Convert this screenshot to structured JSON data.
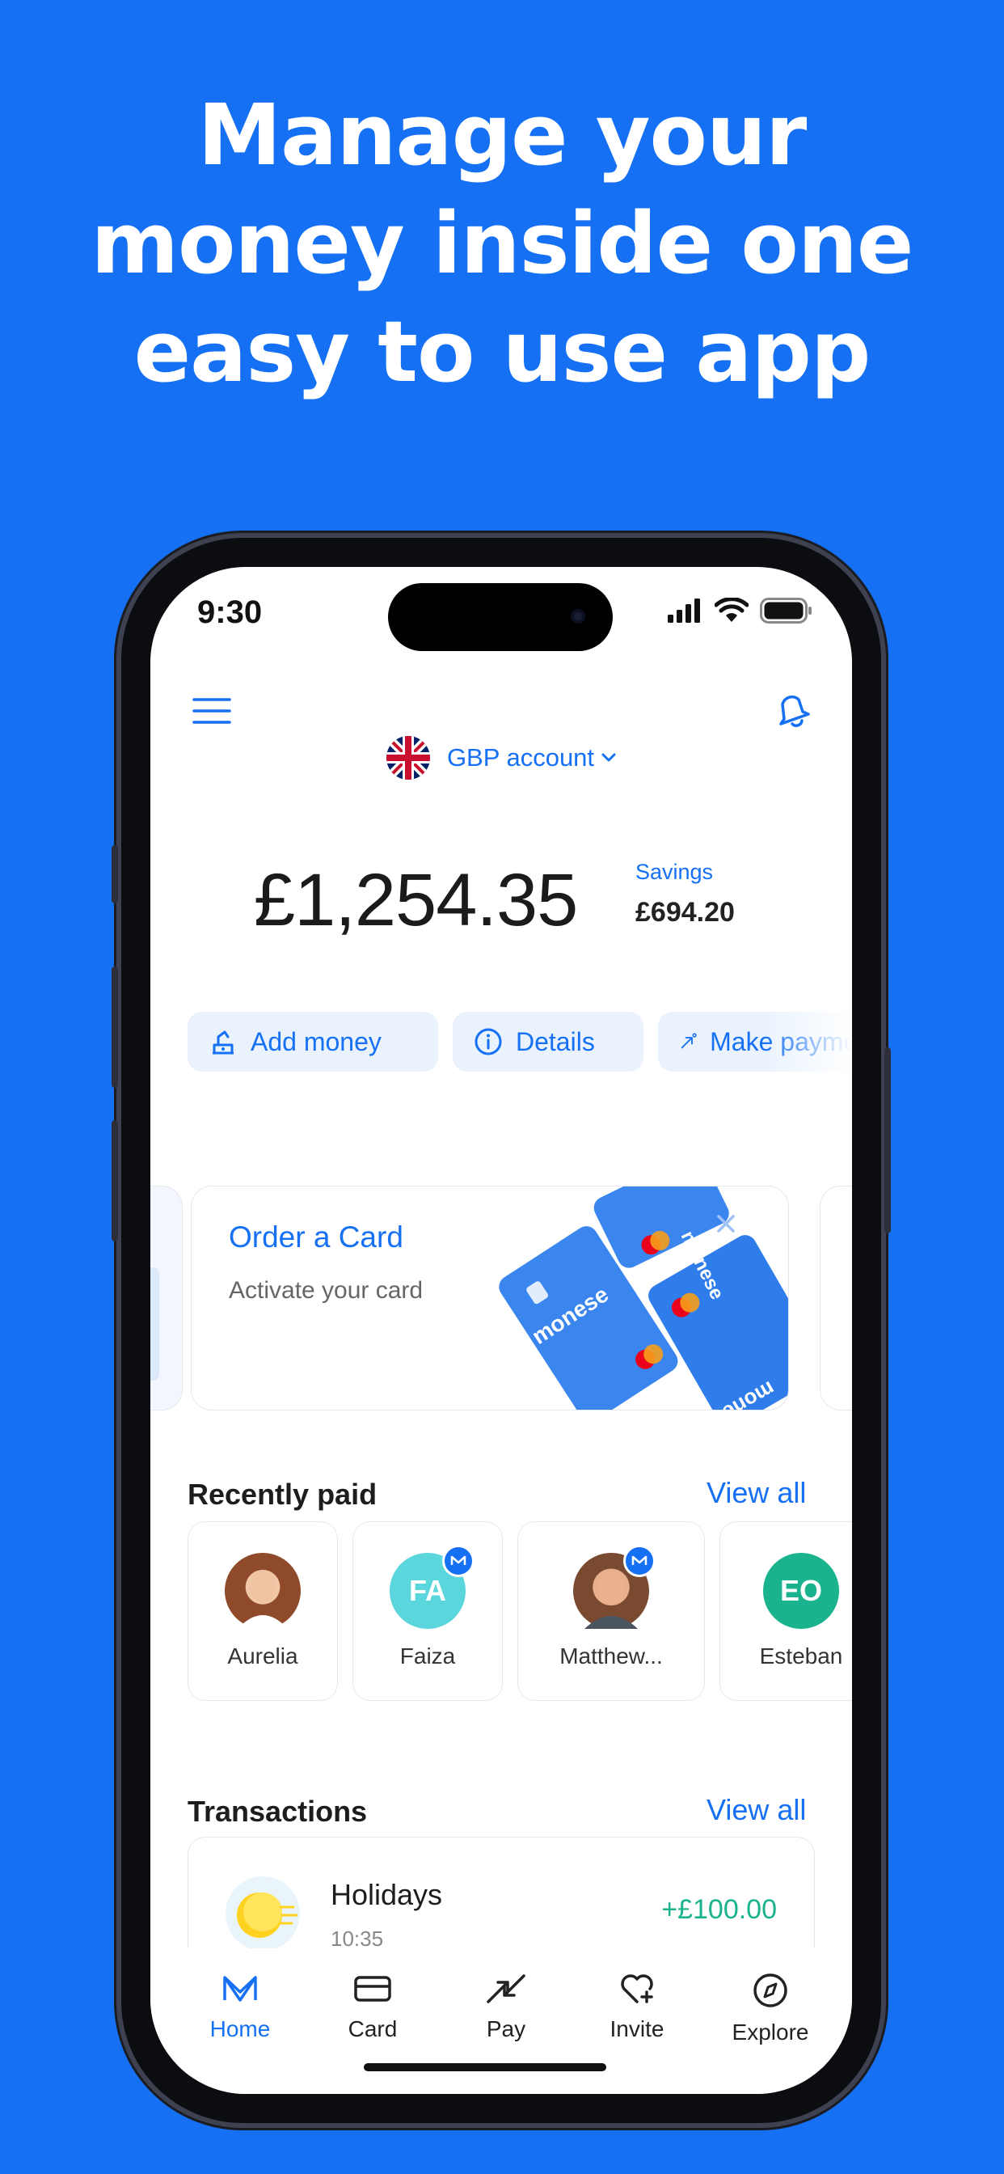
{
  "headline": [
    "Manage your",
    "money inside one",
    "easy to use app"
  ],
  "status_bar": {
    "time": "9:30"
  },
  "account": {
    "label": "GBP account",
    "balance": "£1,254.35",
    "savings_label": "Savings",
    "savings_value": "£694.20"
  },
  "actions": [
    {
      "label": "Add money",
      "icon": "add-money-icon"
    },
    {
      "label": "Details",
      "icon": "info-icon"
    },
    {
      "label": "Make payment",
      "icon": "send-arrow-icon"
    }
  ],
  "promo": {
    "title": "Order a Card",
    "subtitle": "Activate your card",
    "card_brand": "monese"
  },
  "recently_paid": {
    "title": "Recently paid",
    "view_all": "View all",
    "contacts": [
      {
        "name": "Aurelia",
        "initials": "",
        "color": "#C98A6B",
        "badge": false
      },
      {
        "name": "Faiza",
        "initials": "FA",
        "color": "#5BD6DC",
        "badge": true
      },
      {
        "name": "Matthew...",
        "initials": "",
        "color": "#A86A48",
        "badge": true
      },
      {
        "name": "Esteban",
        "initials": "EO",
        "color": "#1BB38E",
        "badge": false
      }
    ]
  },
  "transactions": {
    "title": "Transactions",
    "view_all": "View all",
    "items": [
      {
        "name": "Holidays",
        "time": "10:35",
        "amount": "+£100.00",
        "amount_color": "#1BB38E"
      }
    ]
  },
  "tabs": [
    {
      "label": "Home",
      "icon": "monese-logo-icon",
      "active": true
    },
    {
      "label": "Card",
      "icon": "card-icon",
      "active": false
    },
    {
      "label": "Pay",
      "icon": "pay-arrows-icon",
      "active": false
    },
    {
      "label": "Invite",
      "icon": "heart-plus-icon",
      "active": false
    },
    {
      "label": "Explore",
      "icon": "compass-icon",
      "active": false
    }
  ],
  "colors": {
    "brand": "#1570F4",
    "positive": "#1BB38E",
    "pill_bg": "#EAF3FD"
  }
}
